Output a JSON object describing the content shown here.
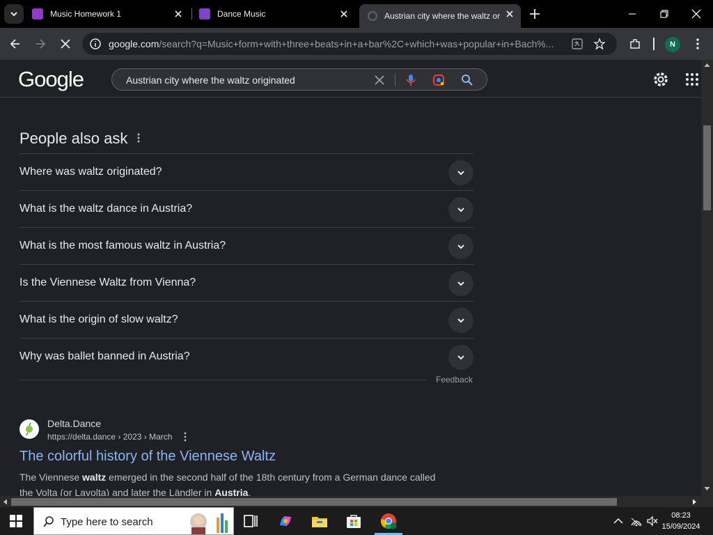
{
  "browser": {
    "tabs": [
      {
        "title": "Music Homework 1",
        "active": false
      },
      {
        "title": "Dance Music",
        "active": false
      },
      {
        "title": "Austrian city where the waltz or",
        "active": true
      }
    ],
    "url_host": "google.com",
    "url_path": "/search?q=Music+form+with+three+beats+in+a+bar%2C+which+was+popular+in+Bach%...",
    "profile_initial": "N"
  },
  "google": {
    "logo": "Google",
    "query": "Austrian city where the waltz originated"
  },
  "people_also_ask": {
    "title": "People also ask",
    "questions": [
      "Where was waltz originated?",
      "What is the waltz dance in Austria?",
      "What is the most famous waltz in Austria?",
      "Is the Viennese Waltz from Vienna?",
      "What is the origin of slow waltz?",
      "Why was ballet banned in Austria?"
    ],
    "feedback": "Feedback"
  },
  "result": {
    "site_name": "Delta.Dance",
    "site_url": "https://delta.dance › 2023 › March",
    "title": "The colorful history of the Viennese Waltz",
    "snippet_parts": [
      "The Viennese ",
      "waltz",
      " emerged in the second half of the 18th century from a German dance called the Volta (or Lavolta) and later the Ländler in ",
      "Austria",
      "."
    ]
  },
  "taskbar": {
    "search_placeholder": "Type here to search",
    "time": "08:23",
    "date": "15/09/2024"
  },
  "colors": {
    "accent_link": "#8ab4f8",
    "background": "#202124"
  }
}
